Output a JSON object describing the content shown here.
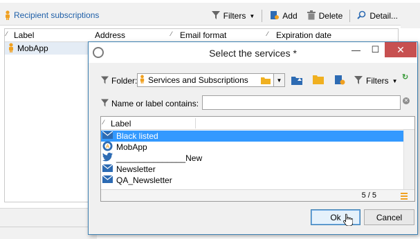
{
  "background": {
    "tab_label": "Recipient subscriptions",
    "toolbar": {
      "filters_label": "Filters",
      "add_label": "Add",
      "delete_label": "Delete",
      "detail_label": "Detail..."
    },
    "columns": [
      "Label",
      "Address",
      "Email format",
      "Expiration date"
    ],
    "rows": [
      {
        "label": "MobApp"
      }
    ]
  },
  "dialog": {
    "title": "Select the services *",
    "minimize_label": "—",
    "maximize_label": "☐",
    "close_label": "✕",
    "folder_label": "Folder:",
    "folder_value": "Services and Subscriptions",
    "filters_label": "Filters",
    "search_label": "Name or label contains:",
    "search_value": "",
    "grid": {
      "column_label": "Label",
      "rows": [
        {
          "label": "Black listed",
          "icon": "mail-icon",
          "selected": true
        },
        {
          "label": "MobApp",
          "icon": "mobile-app-icon",
          "selected": false
        },
        {
          "label": "_______________New",
          "icon": "twitter-icon",
          "selected": false
        },
        {
          "label": "Newsletter",
          "icon": "mail-icon",
          "selected": false
        },
        {
          "label": "QA_Newsletter",
          "icon": "mail-icon",
          "selected": false
        }
      ],
      "count": "5 / 5"
    },
    "ok_label": "Ok",
    "cancel_label": "Cancel"
  },
  "colors": {
    "accent_blue": "#3399ff",
    "title_border": "#3c7fb1",
    "close_red": "#c75050",
    "link_blue": "#1e5fa8",
    "orange_icon": "#f0a020"
  }
}
